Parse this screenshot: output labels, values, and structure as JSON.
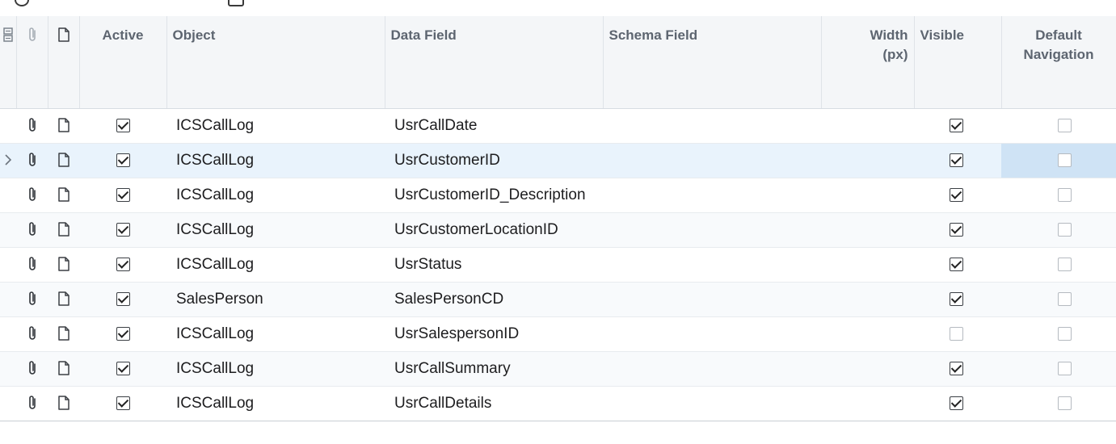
{
  "header": {
    "active": "Active",
    "object": "Object",
    "data_field": "Data Field",
    "schema_field": "Schema Field",
    "width_line1": "Width",
    "width_line2": "(px)",
    "visible": "Visible",
    "default_nav_line1": "Default",
    "default_nav_line2": "Navigation"
  },
  "rows": [
    {
      "object": "ICSCallLog",
      "data_field": "UsrCallDate",
      "schema_field": "",
      "width": "",
      "active": true,
      "visible": true,
      "default_navigation": false
    },
    {
      "object": "ICSCallLog",
      "data_field": "UsrCustomerID",
      "schema_field": "",
      "width": "",
      "active": true,
      "visible": true,
      "default_navigation": false
    },
    {
      "object": "ICSCallLog",
      "data_field": "UsrCustomerID_Description",
      "schema_field": "",
      "width": "",
      "active": true,
      "visible": true,
      "default_navigation": false
    },
    {
      "object": "ICSCallLog",
      "data_field": "UsrCustomerLocationID",
      "schema_field": "",
      "width": "",
      "active": true,
      "visible": true,
      "default_navigation": false
    },
    {
      "object": "ICSCallLog",
      "data_field": "UsrStatus",
      "schema_field": "",
      "width": "",
      "active": true,
      "visible": true,
      "default_navigation": false
    },
    {
      "object": "SalesPerson",
      "data_field": "SalesPersonCD",
      "schema_field": "",
      "width": "",
      "active": true,
      "visible": true,
      "default_navigation": false
    },
    {
      "object": "ICSCallLog",
      "data_field": "UsrSalespersonID",
      "schema_field": "",
      "width": "",
      "active": true,
      "visible": false,
      "default_navigation": false
    },
    {
      "object": "ICSCallLog",
      "data_field": "UsrCallSummary",
      "schema_field": "",
      "width": "",
      "active": true,
      "visible": true,
      "default_navigation": false
    },
    {
      "object": "ICSCallLog",
      "data_field": "UsrCallDetails",
      "schema_field": "",
      "width": "",
      "active": true,
      "visible": true,
      "default_navigation": false
    }
  ],
  "icons": {
    "selector_header": "row-selector-icon",
    "attachment": "paperclip-icon",
    "note": "note-icon",
    "current_row": "chevron-right-icon"
  },
  "colors": {
    "header_bg": "#f4f6f8",
    "selected_row": "#e9f3fc",
    "focused_cell": "#cfe3f5"
  }
}
